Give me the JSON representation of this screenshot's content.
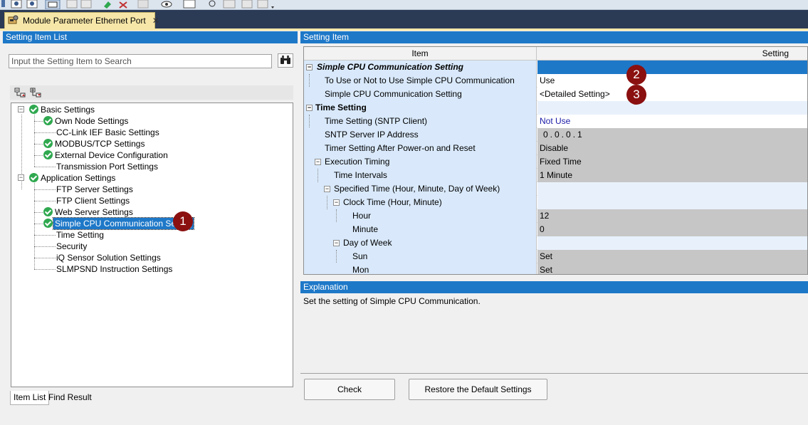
{
  "tab": {
    "title": "Module Parameter Ethernet Port",
    "close": "✕"
  },
  "left": {
    "header": "Setting Item List",
    "search_placeholder": "Input the Setting Item to Search",
    "tree": [
      {
        "label": "Basic Settings",
        "check": true
      },
      {
        "label": "Own Node Settings",
        "check": true
      },
      {
        "label": "CC-Link IEF Basic Settings",
        "check": false
      },
      {
        "label": "MODBUS/TCP Settings",
        "check": true
      },
      {
        "label": "External Device Configuration",
        "check": true
      },
      {
        "label": "Transmission Port Settings",
        "check": false
      },
      {
        "label": "Application Settings",
        "check": true
      },
      {
        "label": "FTP Server Settings",
        "check": false
      },
      {
        "label": "FTP Client Settings",
        "check": false
      },
      {
        "label": "Web Server Settings",
        "check": true
      },
      {
        "label": "Simple CPU Communication Setting",
        "check": true
      },
      {
        "label": "Time Setting",
        "check": false
      },
      {
        "label": "Security",
        "check": false
      },
      {
        "label": "iQ Sensor Solution Settings",
        "check": false
      },
      {
        "label": "SLMPSND Instruction Settings",
        "check": false
      }
    ],
    "bottom_tabs": [
      "Item List",
      "Find Result"
    ]
  },
  "right": {
    "header": "Setting Item",
    "columns": {
      "item": "Item",
      "setting": "Setting"
    },
    "rows": [
      {
        "item": "Simple CPU Communication Setting",
        "value": ""
      },
      {
        "item": "To Use or Not to Use Simple CPU Communication",
        "value": "Use"
      },
      {
        "item": "Simple CPU Communication Setting",
        "value": "<Detailed Setting>"
      },
      {
        "item": "Time Setting",
        "value": ""
      },
      {
        "item": "Time Setting (SNTP Client)",
        "value": "Not Use"
      },
      {
        "item": "SNTP Server IP Address",
        "value": "0.0.0.1"
      },
      {
        "item": "Timer Setting After Power-on and Reset",
        "value": "Disable"
      },
      {
        "item": "Execution Timing",
        "value": "Fixed Time"
      },
      {
        "item": "Time Intervals",
        "value": "1 Minute"
      },
      {
        "item": "Specified Time (Hour, Minute, Day of Week)",
        "value": ""
      },
      {
        "item": "Clock Time (Hour, Minute)",
        "value": ""
      },
      {
        "item": "Hour",
        "value": "12"
      },
      {
        "item": "Minute",
        "value": "0"
      },
      {
        "item": "Day of Week",
        "value": ""
      },
      {
        "item": "Sun",
        "value": "Set"
      },
      {
        "item": "Mon",
        "value": "Set"
      }
    ],
    "explanation_header": "Explanation",
    "explanation_text": "Set the setting of Simple CPU Communication.",
    "check_button": "Check",
    "restore_button": "Restore the Default Settings"
  },
  "badges": [
    "1",
    "2",
    "3"
  ],
  "colors": {
    "header_blue": "#1e78c8",
    "tab_yellow": "#f6e7a9",
    "badge_red": "#8b1010",
    "check_green": "#2fa84f"
  }
}
